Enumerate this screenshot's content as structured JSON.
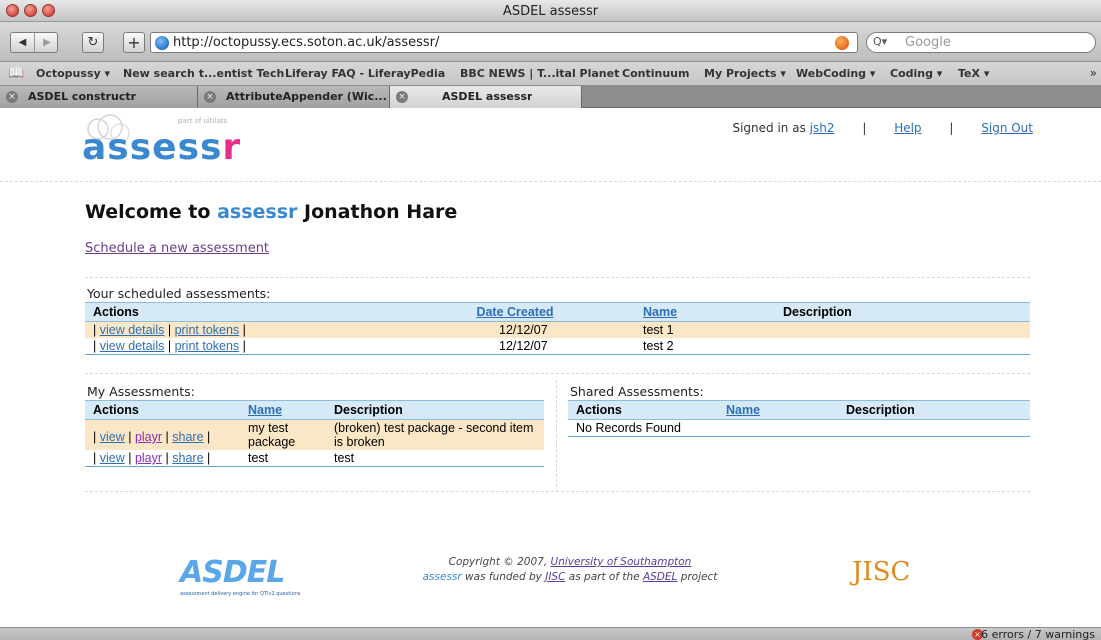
{
  "window": {
    "title": "ASDEL assessr"
  },
  "toolbar": {
    "url": "http://octopussy.ecs.soton.ac.uk/assessr/",
    "search_engine": "Q▾",
    "search_placeholder": "Google"
  },
  "bookmarks": [
    "Octopussy ▾",
    "New search t...entist Tech",
    "Liferay FAQ - LiferayPedia",
    "BBC NEWS | T...ital Planet",
    "Continuum",
    "My Projects ▾",
    "WebCoding ▾",
    "Coding ▾",
    "TeX ▾"
  ],
  "tabs": [
    "ASDEL constructr",
    "AttributeAppender (Wic...",
    "ASDEL assessr"
  ],
  "header": {
    "logo_a": "assess",
    "logo_r": "r",
    "logo_tagline": "part of ultilats",
    "signed_in_as": "Signed in as",
    "username": "jsh2",
    "help": "Help",
    "sign_out": "Sign Out",
    "separator": "|"
  },
  "main": {
    "welcome_prefix": "Welcome to",
    "welcome_brand": "assessr",
    "welcome_name": "Jonathon Hare",
    "schedule_link": "Schedule a new assessment"
  },
  "scheduled": {
    "title": "Your scheduled assessments:",
    "headers": [
      "Actions",
      "Date Created",
      "Name",
      "Description"
    ],
    "rows": [
      {
        "date": "12/12/07",
        "name": "test 1",
        "description": ""
      },
      {
        "date": "12/12/07",
        "name": "test 2",
        "description": ""
      }
    ],
    "view_details": "view details",
    "print_tokens": "print tokens"
  },
  "my_assessments": {
    "title": "My Assessments:",
    "headers": [
      "Actions",
      "Name",
      "Description"
    ],
    "rows": [
      {
        "name": "my test package",
        "description": "(broken) test package - second item is broken"
      },
      {
        "name": "test",
        "description": "test"
      }
    ],
    "view": "view",
    "playr": "playr",
    "share": "share"
  },
  "shared_assessments": {
    "title": "Shared Assessments:",
    "headers": [
      "Actions",
      "Name",
      "Description"
    ],
    "empty": "No Records Found"
  },
  "footer": {
    "asdel_logo": "ASDEL",
    "asdel_sub": "assessment delivery engine for QTIv2 questions",
    "copyright": "Copyright © 2007,",
    "university": "University of Southampton",
    "funded_brand": "assessr",
    "funded_1": "was funded by",
    "jisc_link": "JISC",
    "funded_2": "as part of the",
    "asdel_link": "ASDEL",
    "funded_3": "project",
    "jisc_logo": "JISC"
  },
  "status": {
    "errors": "6 errors / 7 warnings"
  },
  "colors": {
    "accent": "#3a88cf",
    "brand_pink": "#e8308b",
    "header_bg": "#d6e9f7",
    "row_highlight": "#fbe7c6",
    "jisc": "#e0891d"
  }
}
